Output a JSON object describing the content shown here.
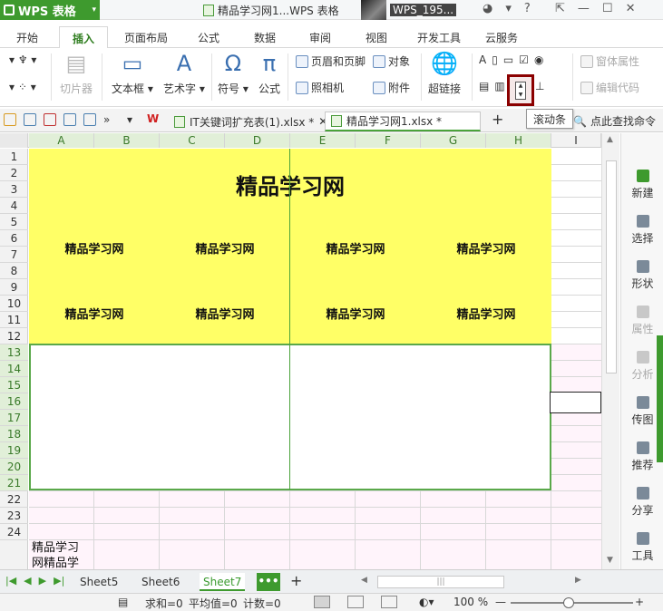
{
  "titlebar": {
    "app_name": "WPS 表格",
    "document_title": "精品学习网1...WPS 表格",
    "user_name": "WPS_195..."
  },
  "menu": {
    "tabs": [
      "开始",
      "插入",
      "页面布局",
      "公式",
      "数据",
      "审阅",
      "视图",
      "开发工具",
      "云服务"
    ],
    "active": "插入"
  },
  "ribbon": {
    "slicer": "切片器",
    "textbox": "文本框",
    "wordart": "艺术字",
    "symbol": "符号",
    "formula": "公式",
    "header_footer": "页眉和页脚",
    "camera": "照相机",
    "object": "对象",
    "attachment": "附件",
    "hyperlink": "超链接",
    "form_properties": "窗体属性",
    "edit_code": "编辑代码",
    "symbol_glyph": "Ω",
    "formula_glyph": "π",
    "wordart_glyph": "A",
    "control_a": "A"
  },
  "tooltip": {
    "text": "滚动条"
  },
  "doc_tabs": [
    {
      "label": "IT关键词扩充表(1).xlsx *",
      "active": false
    },
    {
      "label": "精品学习网1.xlsx *",
      "active": true
    }
  ],
  "find_command": "点此查找命令",
  "columns": [
    "A",
    "B",
    "C",
    "D",
    "E",
    "F",
    "G",
    "H",
    "I"
  ],
  "rows": [
    "1",
    "2",
    "3",
    "4",
    "5",
    "6",
    "7",
    "8",
    "9",
    "10",
    "11",
    "12",
    "13",
    "14",
    "15",
    "16",
    "17",
    "18",
    "19",
    "20",
    "21",
    "22",
    "23",
    "24"
  ],
  "cells": {
    "title": "精品学习网",
    "row6": [
      "精品学习网",
      "精品学习网",
      "精品学习网",
      "精品学习网"
    ],
    "row10": [
      "精品学习网",
      "精品学习网",
      "精品学习网",
      "精品学习网"
    ],
    "a25_line1": "精品学习",
    "a25_line2": "网精品学"
  },
  "sidepane": [
    "新建",
    "选择",
    "形状",
    "属性",
    "分析",
    "传图",
    "推荐",
    "分享",
    "工具"
  ],
  "sheets": [
    "Sheet5",
    "Sheet6",
    "Sheet7"
  ],
  "active_sheet": "Sheet7",
  "more_sheets": "•••",
  "add_sheet": "+",
  "status": {
    "sum": "求和=0",
    "average": "平均值=0",
    "count": "计数=0",
    "zoom": "100 %"
  }
}
